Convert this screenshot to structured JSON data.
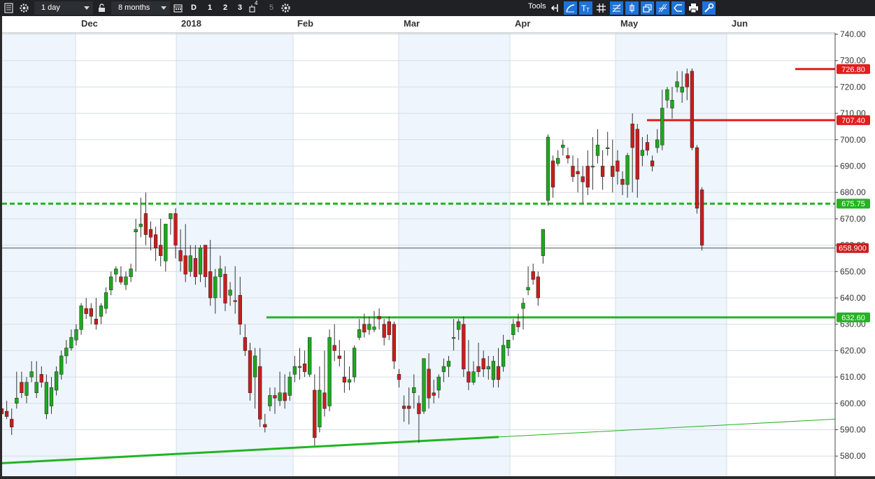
{
  "toolbar": {
    "interval": "1 day",
    "range": "8 months",
    "period_buttons": [
      "D",
      "1",
      "2",
      "3",
      "4",
      "5"
    ],
    "tools_label": "Tools",
    "icons": [
      "menu-icon",
      "settings-icon",
      "lock-icon",
      "calendar-icon",
      "chart-type-icon",
      "gear-icon",
      "back-arrow-icon",
      "curve-tool-icon",
      "text-tool-icon",
      "grid-tool-icon",
      "fib-tool-icon",
      "marker-tool-icon",
      "layers-tool-icon",
      "pitchfork-tool-icon",
      "shape-tool-icon",
      "print-icon",
      "indicator-settings-icon"
    ]
  },
  "chart_data": {
    "type": "candlestick",
    "x_labels": [
      "Dec",
      "2018",
      "Feb",
      "Mar",
      "Apr",
      "May",
      "Jun"
    ],
    "y_ticks": [
      "740.00",
      "730.00",
      "720.00",
      "710.00",
      "700.00",
      "690.00",
      "680.00",
      "670.00",
      "660.00",
      "650.00",
      "640.00",
      "630.00",
      "620.00",
      "610.00",
      "600.00",
      "590.00",
      "580.00",
      "570.00"
    ],
    "ylim": [
      561,
      742
    ],
    "grid": true,
    "current_price": "658.900",
    "levels": [
      {
        "label": "726.80",
        "value": 726.8,
        "color": "#e01e1e",
        "style": "solid"
      },
      {
        "label": "707.40",
        "value": 707.4,
        "color": "#e01e1e",
        "style": "solid"
      },
      {
        "label": "675.75",
        "value": 675.75,
        "color": "#22b422",
        "style": "dashed"
      },
      {
        "label": "632.60",
        "value": 632.6,
        "color": "#22b422",
        "style": "solid"
      }
    ],
    "trendline": {
      "start": 577.3,
      "end_bold": 587.0,
      "end": 594.0,
      "color": "#22b422"
    },
    "colors": {
      "up": "#1ea81e",
      "down": "#c81e1e",
      "wick": "#333333",
      "shade": "#eef5fd"
    },
    "candles": [
      [
        598,
        608,
        596,
        592,
        0
      ],
      [
        595,
        601,
        597,
        594,
        0
      ],
      [
        591,
        598,
        594,
        588,
        0
      ],
      [
        602,
        612,
        600,
        598,
        1
      ],
      [
        604,
        612,
        608,
        602,
        0
      ],
      [
        603,
        610,
        608,
        600,
        1
      ],
      [
        610,
        616,
        612,
        608,
        1
      ],
      [
        604,
        616,
        608,
        602,
        1
      ],
      [
        608,
        614,
        611,
        606,
        0
      ],
      [
        596,
        611,
        608,
        594,
        1
      ],
      [
        599,
        610,
        606,
        596,
        1
      ],
      [
        605,
        614,
        612,
        603,
        1
      ],
      [
        611,
        620,
        618,
        609,
        1
      ],
      [
        618,
        624,
        621,
        615,
        1
      ],
      [
        621,
        628,
        625,
        620,
        1
      ],
      [
        624,
        630,
        628,
        622,
        1
      ],
      [
        628,
        638,
        637,
        626,
        1
      ],
      [
        636,
        640,
        634,
        632,
        0
      ],
      [
        633,
        638,
        636,
        630,
        0
      ],
      [
        630,
        640,
        632,
        628,
        0
      ],
      [
        633,
        638,
        637,
        630,
        1
      ],
      [
        636,
        644,
        642,
        634,
        1
      ],
      [
        643,
        650,
        648,
        641,
        1
      ],
      [
        649,
        652,
        651,
        646,
        1
      ],
      [
        648,
        652,
        646,
        645,
        0
      ],
      [
        645,
        650,
        648,
        643,
        1
      ],
      [
        648,
        653,
        651,
        646,
        1
      ],
      [
        665,
        670,
        666,
        650,
        1
      ],
      [
        667,
        678,
        668,
        663,
        1
      ],
      [
        672,
        680,
        664,
        660,
        0
      ],
      [
        666,
        669,
        663,
        658,
        0
      ],
      [
        664,
        667,
        659,
        654,
        0
      ],
      [
        660,
        670,
        656,
        652,
        0
      ],
      [
        654,
        668,
        668,
        650,
        1
      ],
      [
        670,
        672,
        672,
        664,
        1
      ],
      [
        672,
        674,
        660,
        655,
        0
      ],
      [
        658,
        666,
        654,
        650,
        0
      ],
      [
        656,
        668,
        649,
        646,
        0
      ],
      [
        650,
        660,
        656,
        648,
        1
      ],
      [
        655,
        660,
        648,
        645,
        0
      ],
      [
        649,
        660,
        659,
        646,
        1
      ],
      [
        660,
        660,
        648,
        644,
        0
      ],
      [
        650,
        662,
        640,
        637,
        0
      ],
      [
        640,
        651,
        648,
        634,
        1
      ],
      [
        648,
        656,
        651,
        640,
        1
      ],
      [
        649,
        652,
        638,
        635,
        0
      ],
      [
        641,
        646,
        643,
        637,
        1
      ],
      [
        639,
        652,
        639,
        634,
        0
      ],
      [
        641,
        648,
        630,
        626,
        0
      ],
      [
        625,
        630,
        620,
        618,
        0
      ],
      [
        620,
        623,
        604,
        601,
        0
      ],
      [
        610,
        621,
        618,
        598,
        1
      ],
      [
        614,
        621,
        594,
        591,
        0
      ],
      [
        592,
        596,
        591,
        589,
        0
      ],
      [
        599,
        606,
        603,
        597,
        1
      ],
      [
        603,
        606,
        602,
        596,
        0
      ],
      [
        601,
        612,
        604,
        599,
        1
      ],
      [
        604,
        611,
        601,
        598,
        0
      ],
      [
        603,
        612,
        610,
        601,
        1
      ],
      [
        611,
        618,
        614,
        608,
        1
      ],
      [
        614,
        621,
        614,
        609,
        0
      ],
      [
        615,
        620,
        612,
        610,
        0
      ],
      [
        611,
        625,
        625,
        610,
        1
      ],
      [
        605,
        611,
        587,
        584,
        0
      ],
      [
        591,
        614,
        605,
        589,
        1
      ],
      [
        604,
        620,
        598,
        595,
        0
      ],
      [
        599,
        628,
        625,
        597,
        1
      ],
      [
        622,
        630,
        620,
        616,
        0
      ],
      [
        618,
        624,
        617,
        614,
        0
      ],
      [
        610,
        620,
        608,
        604,
        0
      ],
      [
        608,
        614,
        609,
        605,
        1
      ],
      [
        610,
        622,
        621,
        608,
        1
      ],
      [
        625,
        632,
        628,
        624,
        1
      ],
      [
        630,
        634,
        627,
        625,
        0
      ],
      [
        628,
        633,
        630,
        626,
        1
      ],
      [
        628,
        635,
        629,
        627,
        1
      ],
      [
        633,
        636,
        632,
        628,
        0
      ],
      [
        630,
        632,
        625,
        622,
        0
      ],
      [
        631,
        633,
        626,
        624,
        0
      ],
      [
        630,
        631,
        616,
        613,
        0
      ],
      [
        611,
        613,
        609,
        606,
        0
      ],
      [
        599,
        603,
        598,
        593,
        0
      ],
      [
        599,
        606,
        598,
        592,
        0
      ],
      [
        604,
        611,
        606,
        598,
        1
      ],
      [
        600,
        603,
        596,
        585,
        0
      ],
      [
        597,
        599,
        617,
        596,
        1
      ],
      [
        613,
        619,
        602,
        598,
        0
      ],
      [
        604,
        609,
        603,
        600,
        0
      ],
      [
        605,
        611,
        610,
        602,
        1
      ],
      [
        612,
        617,
        614,
        608,
        1
      ],
      [
        614,
        618,
        616,
        610,
        1
      ],
      [
        625,
        632,
        625,
        620,
        1
      ],
      [
        628,
        632,
        631,
        624,
        1
      ],
      [
        630,
        633,
        613,
        610,
        0
      ],
      [
        612,
        624,
        608,
        605,
        0
      ],
      [
        608,
        616,
        612,
        607,
        1
      ],
      [
        614,
        623,
        612,
        610,
        0
      ],
      [
        617,
        620,
        613,
        610,
        0
      ],
      [
        613,
        618,
        614,
        609,
        1
      ],
      [
        609,
        618,
        616,
        606,
        1
      ],
      [
        614,
        621,
        609,
        606,
        0
      ],
      [
        614,
        626,
        622,
        612,
        1
      ],
      [
        621,
        624,
        624,
        618,
        1
      ],
      [
        626,
        632,
        630,
        624,
        1
      ],
      [
        631,
        634,
        629,
        627,
        0
      ],
      [
        636,
        640,
        638,
        628,
        1
      ],
      [
        643,
        652,
        644,
        641,
        1
      ],
      [
        650,
        653,
        647,
        645,
        0
      ],
      [
        648,
        650,
        640,
        637,
        0
      ],
      [
        656,
        666,
        666,
        653,
        1
      ],
      [
        677,
        702,
        701,
        675,
        1
      ],
      [
        692,
        694,
        682,
        678,
        0
      ],
      [
        693,
        696,
        691,
        690,
        1
      ],
      [
        698,
        700,
        697,
        694,
        1
      ],
      [
        694,
        697,
        693,
        691,
        0
      ],
      [
        690,
        694,
        686,
        684,
        0
      ],
      [
        688,
        693,
        687,
        680,
        0
      ],
      [
        686,
        690,
        684,
        676,
        0
      ],
      [
        690,
        696,
        682,
        679,
        0
      ],
      [
        690,
        701,
        690,
        681,
        1
      ],
      [
        694,
        704,
        698,
        691,
        1
      ],
      [
        690,
        696,
        686,
        681,
        0
      ],
      [
        697,
        703,
        697,
        694,
        1
      ],
      [
        690,
        700,
        686,
        680,
        0
      ],
      [
        692,
        696,
        688,
        683,
        0
      ],
      [
        685,
        688,
        683,
        679,
        0
      ],
      [
        683,
        695,
        694,
        678,
        1
      ],
      [
        706,
        710,
        697,
        680,
        0
      ],
      [
        704,
        706,
        685,
        678,
        0
      ],
      [
        694,
        701,
        696,
        690,
        1
      ],
      [
        699,
        702,
        696,
        694,
        0
      ],
      [
        692,
        694,
        690,
        688,
        0
      ],
      [
        697,
        704,
        700,
        695,
        1
      ],
      [
        698,
        719,
        712,
        696,
        1
      ],
      [
        715,
        720,
        719,
        712,
        1
      ],
      [
        712,
        720,
        715,
        708,
        1
      ],
      [
        720,
        726,
        722,
        718,
        1
      ],
      [
        718,
        726,
        720,
        714,
        1
      ],
      [
        725,
        727,
        720,
        715,
        0
      ],
      [
        726,
        727,
        697,
        696,
        0
      ],
      [
        697,
        698,
        674,
        672,
        0
      ],
      [
        681,
        682,
        660,
        658,
        0
      ]
    ]
  }
}
